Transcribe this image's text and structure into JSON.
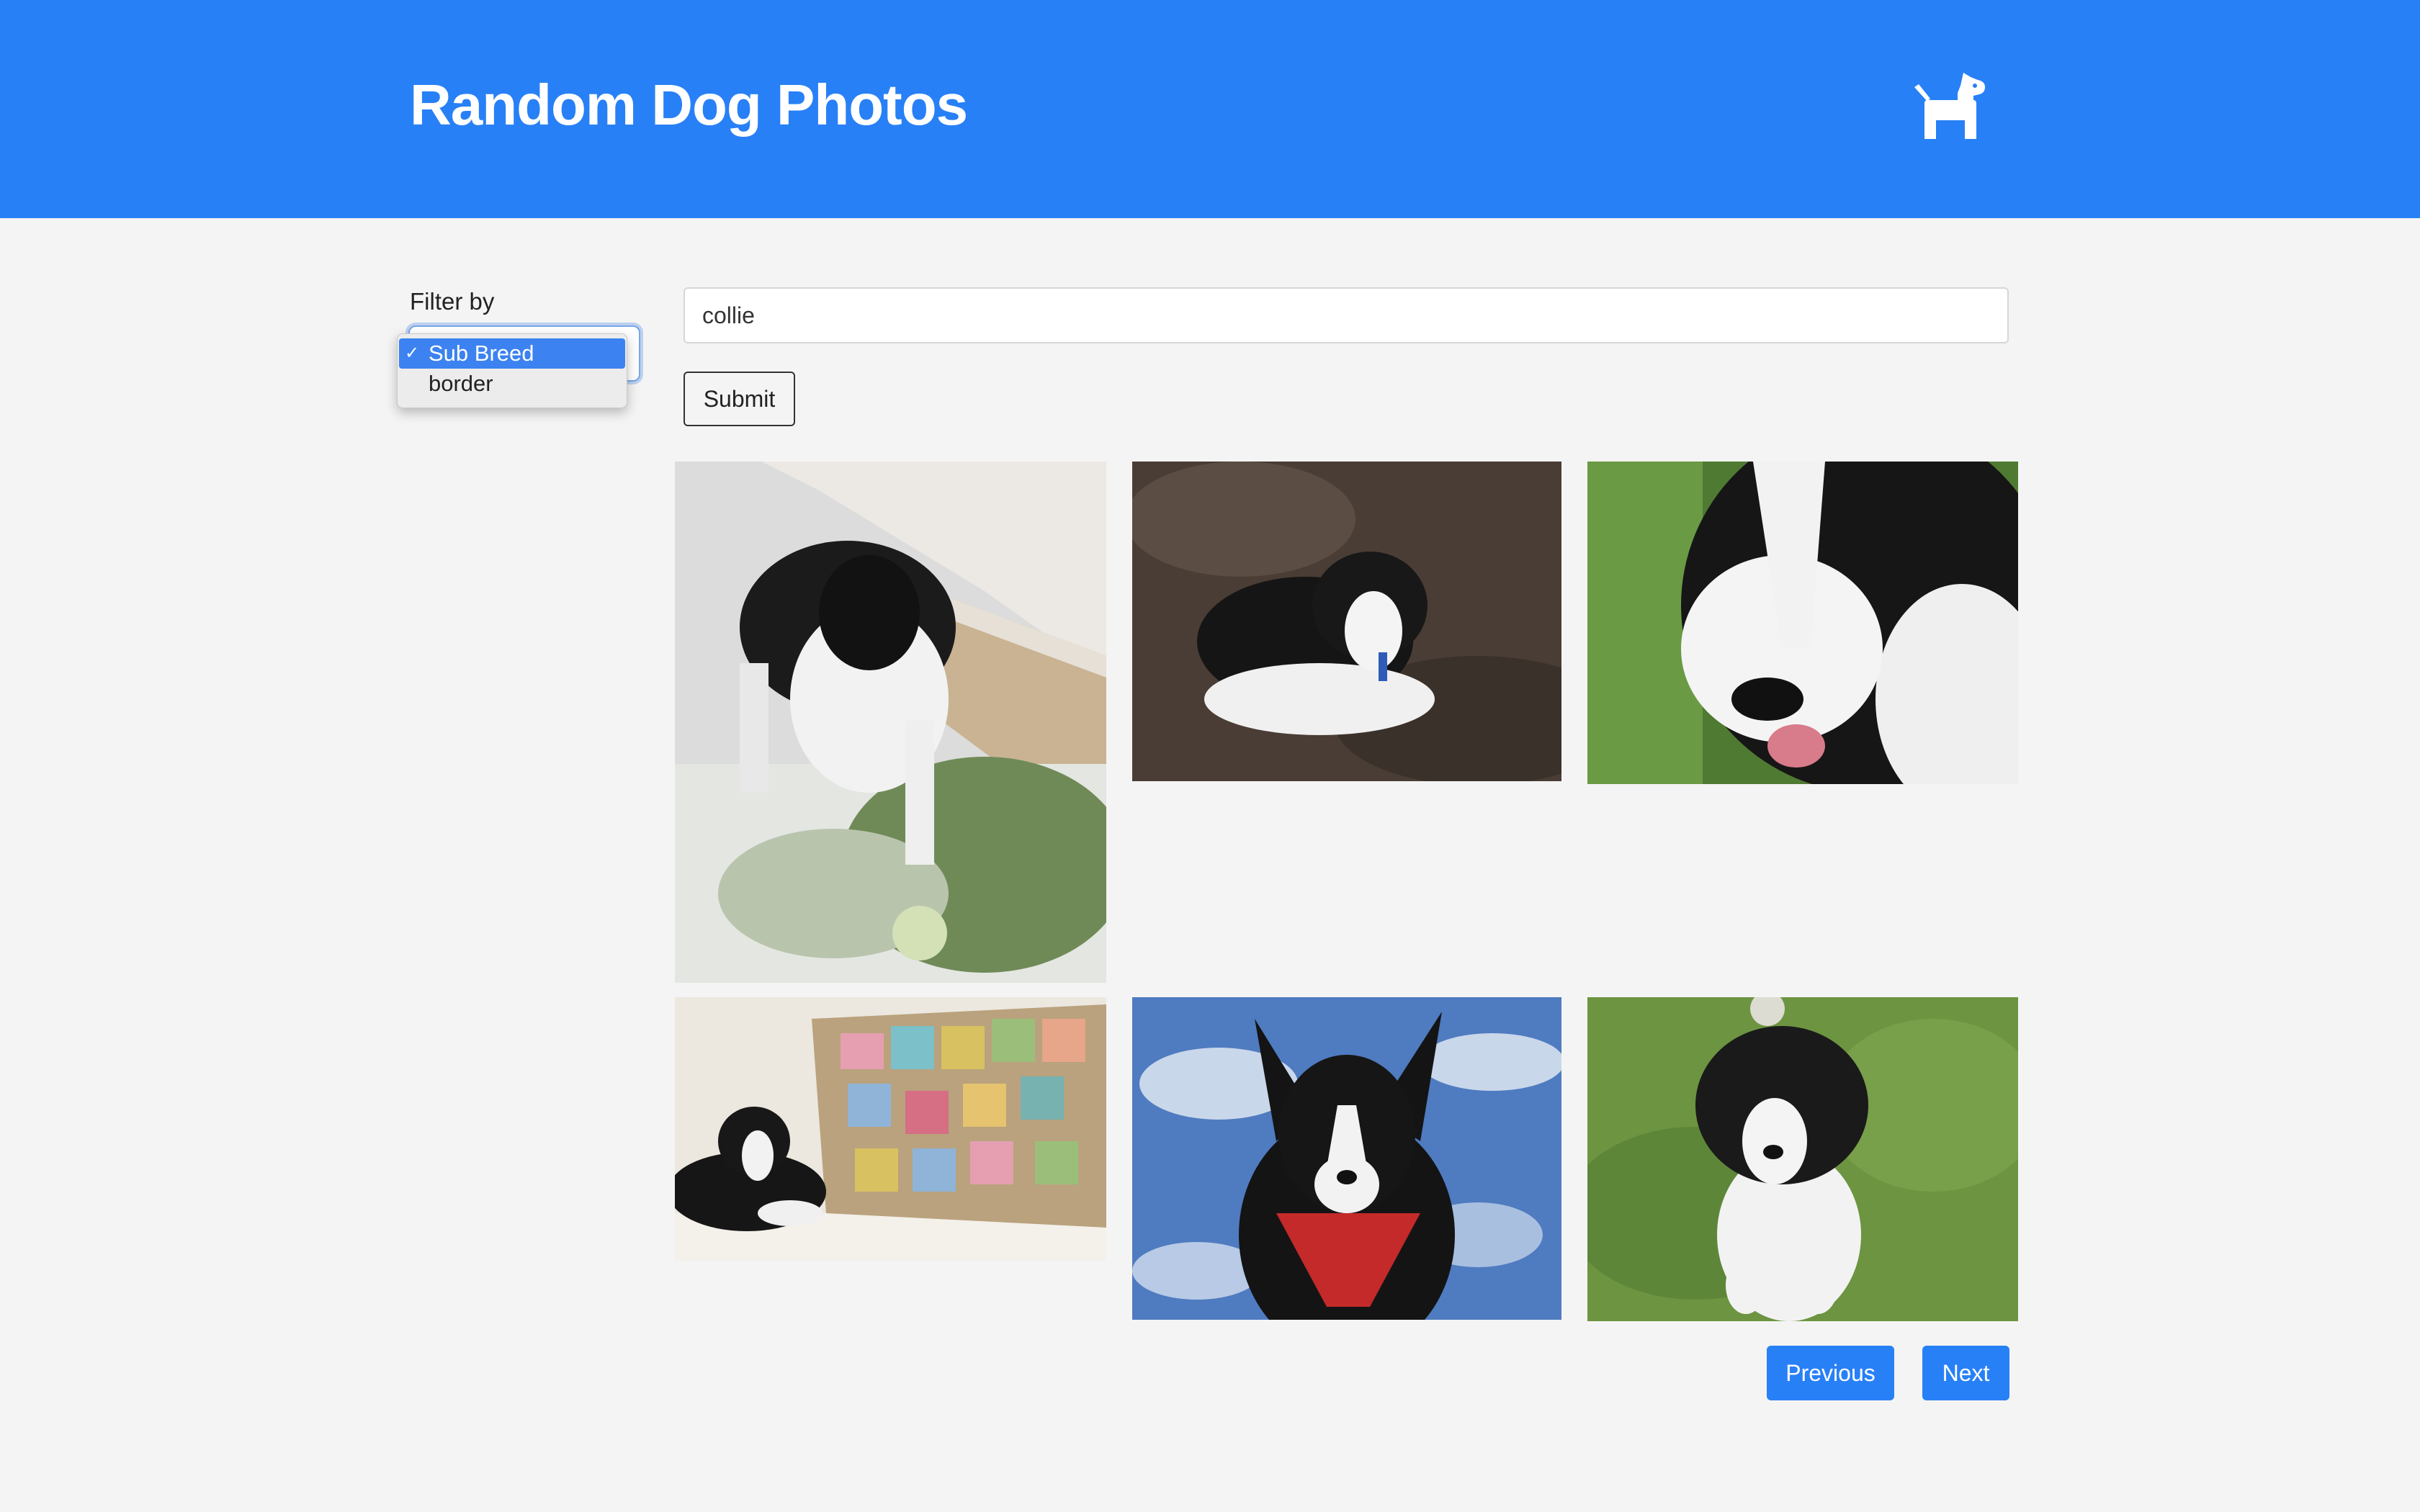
{
  "header": {
    "title": "Random Dog Photos",
    "logo_icon": "dog-icon",
    "background_color": "#2880f6"
  },
  "filter": {
    "label": "Filter by",
    "options": [
      {
        "label": "Sub Breed",
        "selected": true
      },
      {
        "label": "border",
        "selected": false
      }
    ]
  },
  "search": {
    "value": "collie"
  },
  "submit_label": "Submit",
  "photos": [
    {
      "subject": "border collie puppy on snowy grass beside wooden steps"
    },
    {
      "subject": "border collie puppy lying on dirt"
    },
    {
      "subject": "border collie face close-up on grass"
    },
    {
      "subject": "border collie lying on couch with quilt"
    },
    {
      "subject": "border collie with red bandana against blue sky"
    },
    {
      "subject": "black and white puppy sitting on grass"
    }
  ],
  "pagination": {
    "previous_label": "Previous",
    "next_label": "Next"
  }
}
